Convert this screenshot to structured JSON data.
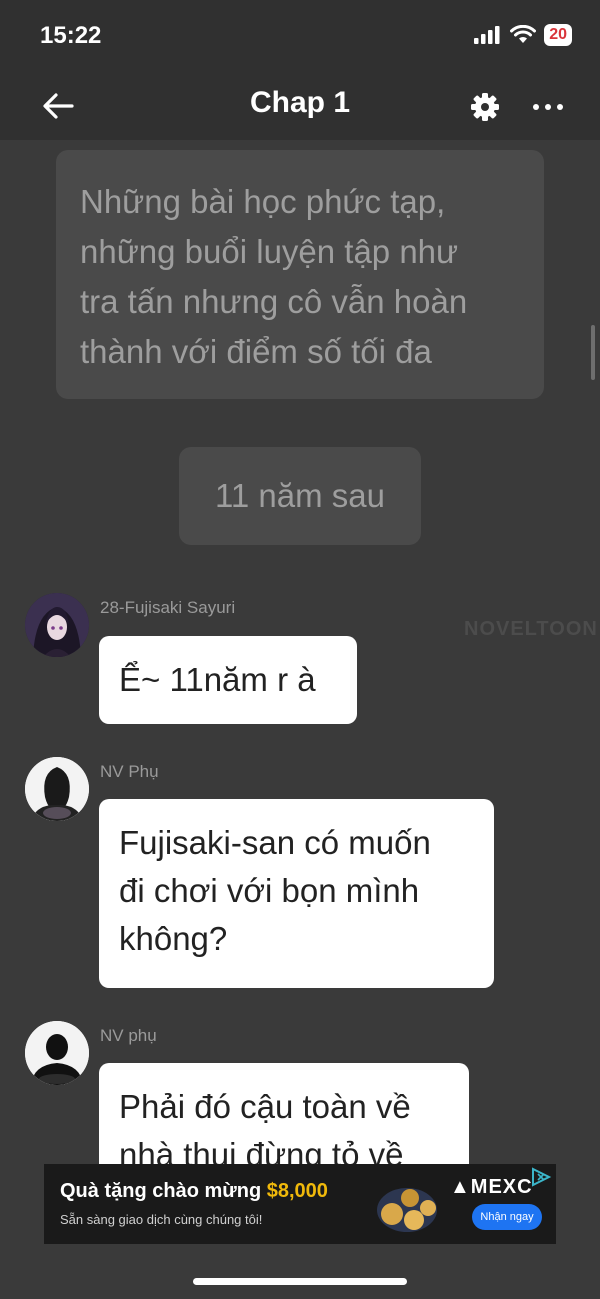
{
  "status_bar": {
    "time": "15:22",
    "battery": "20"
  },
  "header": {
    "title": "Chap 1"
  },
  "story": {
    "narration_lines": [
      "Những bài học phức tạp,",
      "những buổi luyện tập như",
      "tra tấn nhưng cô vẫn hoàn",
      "thành với điểm số tối đa"
    ],
    "timeskip": "11 năm sau",
    "watermark": "NOVELTOON",
    "messages": [
      {
        "speaker": "28-Fujisaki Sayuri",
        "lines": [
          "Ể~ 11năm r à"
        ]
      },
      {
        "speaker": "NV Phụ",
        "lines": [
          "Fujisaki-san có muốn",
          "đi chơi với bọn mình",
          "không?"
        ]
      },
      {
        "speaker": "NV phụ",
        "lines": [
          "Phải đó cậu toàn về",
          "nhà thui đừng tỏ về"
        ]
      }
    ]
  },
  "ad": {
    "title": "Quà tặng chào mừng",
    "amount": "$8,000",
    "subtitle": "Sẵn sàng giao dịch cùng chúng tôi!",
    "brand": "MEXC",
    "button": "Nhận ngay"
  },
  "colors": {
    "background": "#3a3a3a",
    "header": "#303030",
    "ad_accent": "#f0b90b",
    "ad_button": "#1e74f2"
  }
}
